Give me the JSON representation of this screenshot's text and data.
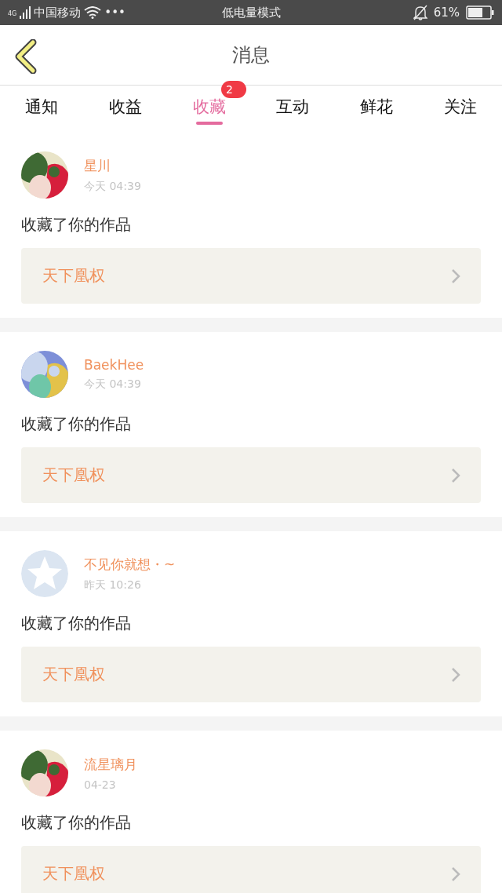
{
  "status_bar": {
    "network": "4G",
    "carrier": "中国移动",
    "dots": "•••",
    "mode": "低电量模式",
    "battery": "61%"
  },
  "header": {
    "title": "消息"
  },
  "tabs": [
    {
      "label": "通知",
      "selected": false
    },
    {
      "label": "收益",
      "selected": false
    },
    {
      "label": "收藏",
      "selected": true,
      "badge": "2"
    },
    {
      "label": "互动",
      "selected": false
    },
    {
      "label": "鲜花",
      "selected": false
    },
    {
      "label": "关注",
      "selected": false
    }
  ],
  "messages": [
    {
      "name": "星川",
      "time": "今天 04:39",
      "text": "收藏了你的作品",
      "work": "天下凰权"
    },
    {
      "name": "BaekHee",
      "time": "今天 04:39",
      "text": "收藏了你的作品",
      "work": "天下凰权"
    },
    {
      "avatar": {
        "kind": "default"
      },
      "name": "不见你就想・~",
      "time": "昨天 10:26",
      "text": "收藏了你的作品",
      "work": "天下凰权"
    },
    {
      "name": "流星璃月",
      "time": "04-23",
      "text": "收藏了你的作品",
      "work": "天下凰权"
    }
  ]
}
